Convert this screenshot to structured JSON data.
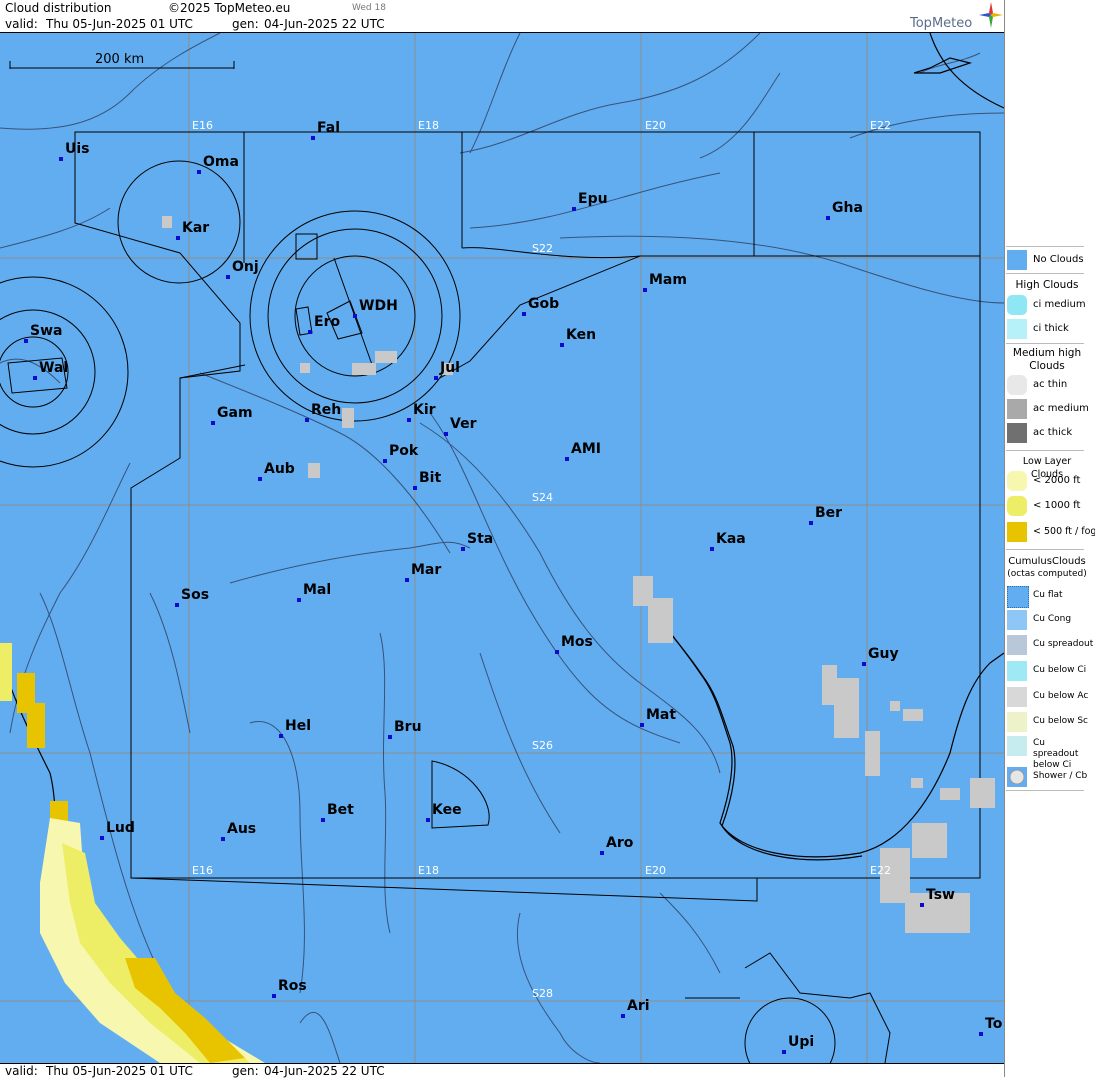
{
  "header": {
    "title": "Cloud distribution",
    "copyright": "©2025 TopMeteo.eu",
    "small_tag": "Wed 18",
    "brand": "TopMeteo",
    "valid_label": "valid:",
    "valid_value": "Thu  05-Jun-2025  01 UTC",
    "gen_label": "gen:",
    "gen_value": "04-Jun-2025 22 UTC"
  },
  "footer": {
    "valid_label": "valid:",
    "valid_value": "Thu  05-Jun-2025  01 UTC",
    "gen_label": "gen:",
    "gen_value": "04-Jun-2025 22 UTC"
  },
  "scale_bar": "200 km",
  "grid_labels": {
    "E16_top": "E16",
    "E18_top": "E18",
    "E20_top": "E20",
    "E22_top": "E22",
    "E16_bot": "E16",
    "E18_bot": "E18",
    "E20_bot": "E20",
    "E22_bot": "E22",
    "S22": "S22",
    "S24": "S24",
    "S26": "S26",
    "S28": "S28"
  },
  "stations": {
    "uis": "Uis",
    "fal": "Fal",
    "oma": "Oma",
    "kar": "Kar",
    "epu": "Epu",
    "gha": "Gha",
    "onj": "Onj",
    "mam": "Mam",
    "gob": "Gob",
    "wdh": "WDH",
    "ero": "Ero",
    "ken": "Ken",
    "swa": "Swa",
    "wal": "Wal",
    "jul": "Jul",
    "gam": "Gam",
    "reh": "Reh",
    "kir": "Kir",
    "ver": "Ver",
    "ami": "AMI",
    "pok": "Pok",
    "aub": "Aub",
    "bit": "Bit",
    "ber": "Ber",
    "sta": "Sta",
    "kaa": "Kaa",
    "mar": "Mar",
    "sos": "Sos",
    "mal": "Mal",
    "mos": "Mos",
    "guy": "Guy",
    "mat": "Mat",
    "hel": "Hel",
    "bru": "Bru",
    "bet": "Bet",
    "kee": "Kee",
    "lud": "Lud",
    "aus": "Aus",
    "aro": "Aro",
    "tsw": "Tsw",
    "ros": "Ros",
    "ari": "Ari",
    "to": "To",
    "upi": "Upi"
  },
  "legend": {
    "no_clouds": "No Clouds",
    "high_head": "High Clouds",
    "ci_medium": "ci medium",
    "ci_thick": "ci thick",
    "medium_head": "Medium high Clouds",
    "ac_thin": "ac thin",
    "ac_medium": "ac medium",
    "ac_thick": "ac thick",
    "low_head": "Low Layer Clouds",
    "low_2000": "< 2000 ft",
    "low_1000": "< 1000 ft",
    "low_500": "< 500 ft / fog",
    "cu_head": "CumulusClouds",
    "cu_sub": "(octas computed)",
    "cu_flat": "Cu flat",
    "cu_cong": "Cu Cong",
    "cu_spread": "Cu spreadout",
    "cu_below_ci": "Cu below Ci",
    "cu_below_ac": "Cu below Ac",
    "cu_below_sc": "Cu below Sc",
    "cu_spread_ci": "Cu spreadout below Ci",
    "shower": "Shower / Cb"
  },
  "colors": {
    "map_bg": "#62adf0",
    "low_2000": "#f7f7b0",
    "low_1000": "#eeee66",
    "low_500": "#e8c400",
    "cu_below_ac": "#c9c9c9"
  }
}
